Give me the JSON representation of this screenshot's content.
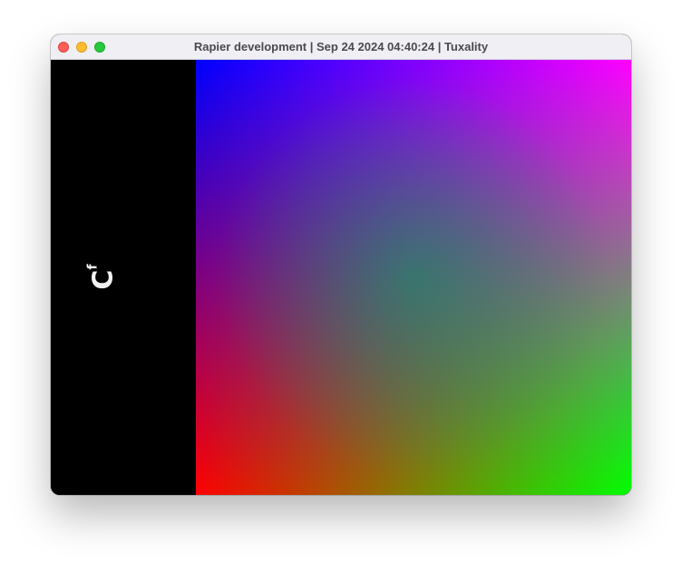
{
  "window": {
    "title": "Rapier development | Sep 24 2024 04:40:24 | Tuxality",
    "traffic_lights": {
      "close": {
        "icon": "close-icon",
        "color": "#fe5f57"
      },
      "minimize": {
        "icon": "minimize-icon",
        "color": "#febc2e"
      },
      "maximize": {
        "icon": "maximize-icon",
        "color": "#28c840"
      }
    }
  },
  "left_panel": {
    "glyph_main": "C",
    "glyph_sub": "f",
    "background": "#000000",
    "glyph_color": "#f2f2f2"
  },
  "canvas": {
    "corner_colors": {
      "top_left": "#0000ff",
      "top_right": "#ff00ff",
      "bottom_left": "#ff0000",
      "bottom_right": "#00ff00"
    },
    "center_color": "#00a060"
  }
}
